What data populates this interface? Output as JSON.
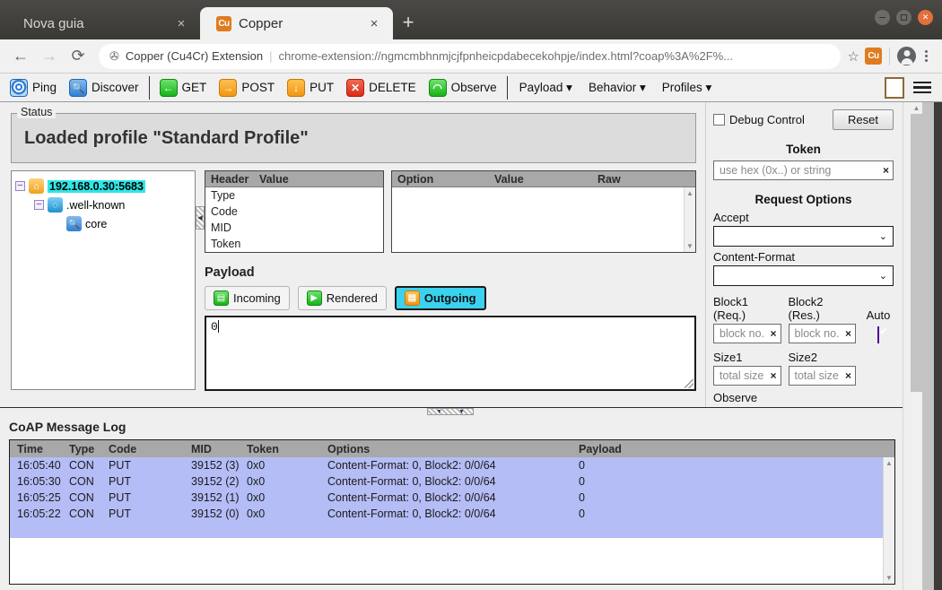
{
  "window": {
    "controls": {
      "minimize": "minimize-icon",
      "maximize": "maximize-icon",
      "close": "close-icon"
    }
  },
  "browser": {
    "tabs": [
      {
        "title": "Nova guia",
        "favicon": "",
        "close": "×",
        "active": false
      },
      {
        "title": "Copper",
        "favicon": "Cu",
        "close": "×",
        "active": true
      }
    ],
    "new_tab_label": "+",
    "nav": {
      "back": "←",
      "forward": "→",
      "reload": "⟳"
    },
    "omnibox": {
      "extension_name": "Copper (Cu4Cr) Extension",
      "separator": "|",
      "url": "chrome-extension://ngmcmbhnmjcjfpnheicpdabecekohpje/index.html?coap%3A%2F%...",
      "star": "☆"
    },
    "extension_badge": "Cu",
    "menu": "kebab-menu"
  },
  "toolbar": {
    "actions": [
      {
        "label": "Ping",
        "icon": "ping-icon",
        "glyph": ""
      },
      {
        "label": "Discover",
        "icon": "discover-icon",
        "glyph": "🔍"
      },
      {
        "label": "GET",
        "icon": "get-icon",
        "glyph": "←"
      },
      {
        "label": "POST",
        "icon": "post-icon",
        "glyph": "→"
      },
      {
        "label": "PUT",
        "icon": "put-icon",
        "glyph": "↓"
      },
      {
        "label": "DELETE",
        "icon": "delete-icon",
        "glyph": "✕"
      },
      {
        "label": "Observe",
        "icon": "observe-icon",
        "glyph": "◠"
      }
    ],
    "menus": [
      {
        "label": "Payload ▾"
      },
      {
        "label": "Behavior ▾"
      },
      {
        "label": "Profiles ▾"
      }
    ]
  },
  "status": {
    "legend": "Status",
    "message": "Loaded profile \"Standard Profile\""
  },
  "tree": {
    "nodes": [
      {
        "label": "192.168.0.30:5683",
        "icon": "home-icon",
        "glyph": "⌂",
        "level": 1,
        "expander": "−",
        "selected": true
      },
      {
        "label": ".well-known",
        "icon": "globe-icon",
        "glyph": "◌",
        "level": 2,
        "expander": "−",
        "selected": false
      },
      {
        "label": "core",
        "icon": "search-icon",
        "glyph": "🔍",
        "level": 3,
        "expander": "",
        "selected": false
      }
    ]
  },
  "header_table": {
    "columns": [
      "Header",
      "Value"
    ],
    "rows": [
      {
        "header": "Type",
        "value": ""
      },
      {
        "header": "Code",
        "value": ""
      },
      {
        "header": "MID",
        "value": ""
      },
      {
        "header": "Token",
        "value": ""
      }
    ]
  },
  "option_table": {
    "columns": [
      "Option",
      "Value",
      "Raw"
    ],
    "rows": []
  },
  "payload": {
    "title": "Payload",
    "tabs": [
      {
        "label": "Incoming",
        "icon": "incoming-icon",
        "active": false
      },
      {
        "label": "Rendered",
        "icon": "rendered-icon",
        "active": false
      },
      {
        "label": "Outgoing",
        "icon": "outgoing-icon",
        "active": true
      }
    ],
    "text": "0"
  },
  "sidebar": {
    "debug_control_label": "Debug Control",
    "debug_control_checked": false,
    "reset_label": "Reset",
    "token_heading": "Token",
    "token_placeholder": "use hex (0x..) or string",
    "token_clear": "×",
    "request_options_heading": "Request Options",
    "accept_label": "Accept",
    "accept_value": "",
    "content_format_label": "Content-Format",
    "content_format_value": "",
    "block1_label": "Block1 (Req.)",
    "block1_placeholder": "block no.",
    "block2_label": "Block2 (Res.)",
    "block2_placeholder": "block no.",
    "auto_label": "Auto",
    "auto_checked": true,
    "size1_label": "Size1",
    "size1_placeholder": "total size",
    "size2_label": "Size2",
    "size2_placeholder": "total size",
    "observe_label": "Observe",
    "clear_glyph": "×",
    "chevron": "⌄"
  },
  "log": {
    "title": "CoAP Message Log",
    "columns": [
      "Time",
      "Type",
      "Code",
      "MID",
      "Token",
      "Options",
      "Payload"
    ],
    "rows": [
      {
        "time": "16:05:40",
        "type": "CON",
        "code": "PUT",
        "mid": "39152 (3)",
        "token": "0x0",
        "options": "Content-Format: 0, Block2: 0/0/64",
        "payload": "0"
      },
      {
        "time": "16:05:30",
        "type": "CON",
        "code": "PUT",
        "mid": "39152 (2)",
        "token": "0x0",
        "options": "Content-Format: 0, Block2: 0/0/64",
        "payload": "0"
      },
      {
        "time": "16:05:25",
        "type": "CON",
        "code": "PUT",
        "mid": "39152 (1)",
        "token": "0x0",
        "options": "Content-Format: 0, Block2: 0/0/64",
        "payload": "0"
      },
      {
        "time": "16:05:22",
        "type": "CON",
        "code": "PUT",
        "mid": "39152 (0)",
        "token": "0x0",
        "options": "Content-Format: 0, Block2: 0/0/64",
        "payload": "0"
      }
    ]
  },
  "colors": {
    "selection_cyan": "#2ee6e6",
    "log_row_blue": "#b4bdf5",
    "active_tab_cyan": "#3ad2ee",
    "auto_checkbox_purple": "#6a0dd8",
    "brand_orange": "#e07b20"
  }
}
